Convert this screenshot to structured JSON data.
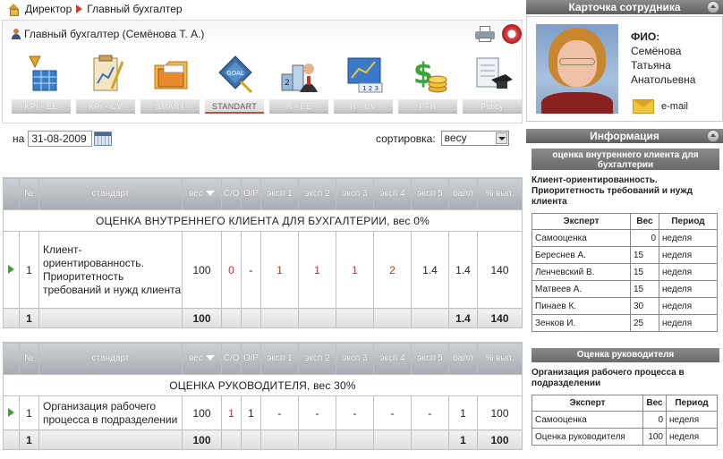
{
  "breadcrumb": {
    "root": "Директор",
    "current": "Главный бухгалтер"
  },
  "header": {
    "user_title": "Главный бухгалтер  (Семёнова Т. А.)"
  },
  "toolbar": {
    "items": [
      {
        "label": "KPI - EE",
        "icon": "kpi-chart-icon"
      },
      {
        "label": "KPI - CV",
        "icon": "clipboard-icon"
      },
      {
        "label": "SMART",
        "icon": "folder-icon"
      },
      {
        "label": "STANDART",
        "icon": "goal-icon"
      },
      {
        "label": "R - EE",
        "icon": "ranking-icon"
      },
      {
        "label": "R - CV",
        "icon": "bar-chart-icon"
      },
      {
        "label": "PFR",
        "icon": "money-icon"
      },
      {
        "label": "Policy",
        "icon": "diploma-icon"
      }
    ],
    "active": "STANDART"
  },
  "filter": {
    "date_label": "на",
    "date_value": "31-08-2009",
    "sort_label": "сортировка:",
    "sort_value": "весу"
  },
  "columns": {
    "num": "№",
    "standard": "стандарт",
    "weight": "вес",
    "so": "С/О",
    "or": "О/Р",
    "e1": "эксп 1",
    "e2": "эксп 2",
    "e3": "эксп 3",
    "e4": "эксп 4",
    "e5": "эксп 5",
    "score": "балл",
    "pct": "% вып."
  },
  "section1": {
    "title": "ОЦЕНКА ВНУТРЕННЕГО КЛИЕНТА ДЛЯ БУХГАЛТЕРИИ, вес 0%",
    "row": {
      "num": "1",
      "standard": "Клиент-ориентированность. Приоритетность требований и нужд клиента",
      "weight": "100",
      "so": "0",
      "or": "-",
      "e1": "1",
      "e2": "1",
      "e3": "1",
      "e4": "2",
      "e5": "1.4",
      "score": "1.4",
      "pct": "140"
    },
    "total": {
      "num": "1",
      "weight": "100",
      "score": "1.4",
      "pct": "140"
    }
  },
  "section2": {
    "title": "ОЦЕНКА РУКОВОДИТЕЛЯ, вес 30%",
    "row": {
      "num": "1",
      "standard": "Организация рабочего процесса в подразделении",
      "weight": "100",
      "so": "1",
      "or": "1",
      "e1": "-",
      "e2": "-",
      "e3": "-",
      "e4": "-",
      "e5": "-",
      "score": "1",
      "pct": "100"
    },
    "total": {
      "num": "1",
      "weight": "100",
      "score": "1",
      "pct": "100"
    }
  },
  "card": {
    "title": "Карточка сотрудника",
    "fio_label": "ФИО:",
    "surname": "Семёнова",
    "name": "Татьяна",
    "patronymic": "Анатольевна",
    "email_label": "e-mail"
  },
  "info": {
    "title": "Информация",
    "block1": {
      "heading": "оценка внутреннего клиента для бухгалтерии",
      "criterion": "Клиент-ориентированность. Приоритетность требований и нужд клиента",
      "headers": [
        "Эксперт",
        "Вес",
        "Период"
      ],
      "rows": [
        {
          "expert": "Самооценка",
          "weight": "0",
          "period": "неделя"
        },
        {
          "expert": "Береснев А.",
          "weight": "15",
          "period": "неделя"
        },
        {
          "expert": "Ленчевский В.",
          "weight": "15",
          "period": "неделя"
        },
        {
          "expert": "Матвеев А.",
          "weight": "15",
          "period": "неделя"
        },
        {
          "expert": "Пинаев К.",
          "weight": "30",
          "period": "неделя"
        },
        {
          "expert": "Зенков И.",
          "weight": "25",
          "period": "неделя"
        }
      ]
    },
    "block2": {
      "heading": "Оценка руководителя",
      "criterion": "Организация рабочего процесса в подразделении",
      "headers": [
        "Эксперт",
        "Вес",
        "Период"
      ],
      "rows": [
        {
          "expert": "Самооценка",
          "weight": "0",
          "period": "неделя"
        },
        {
          "expert": "Оценка руководителя",
          "weight": "100",
          "period": "неделя"
        }
      ]
    }
  }
}
